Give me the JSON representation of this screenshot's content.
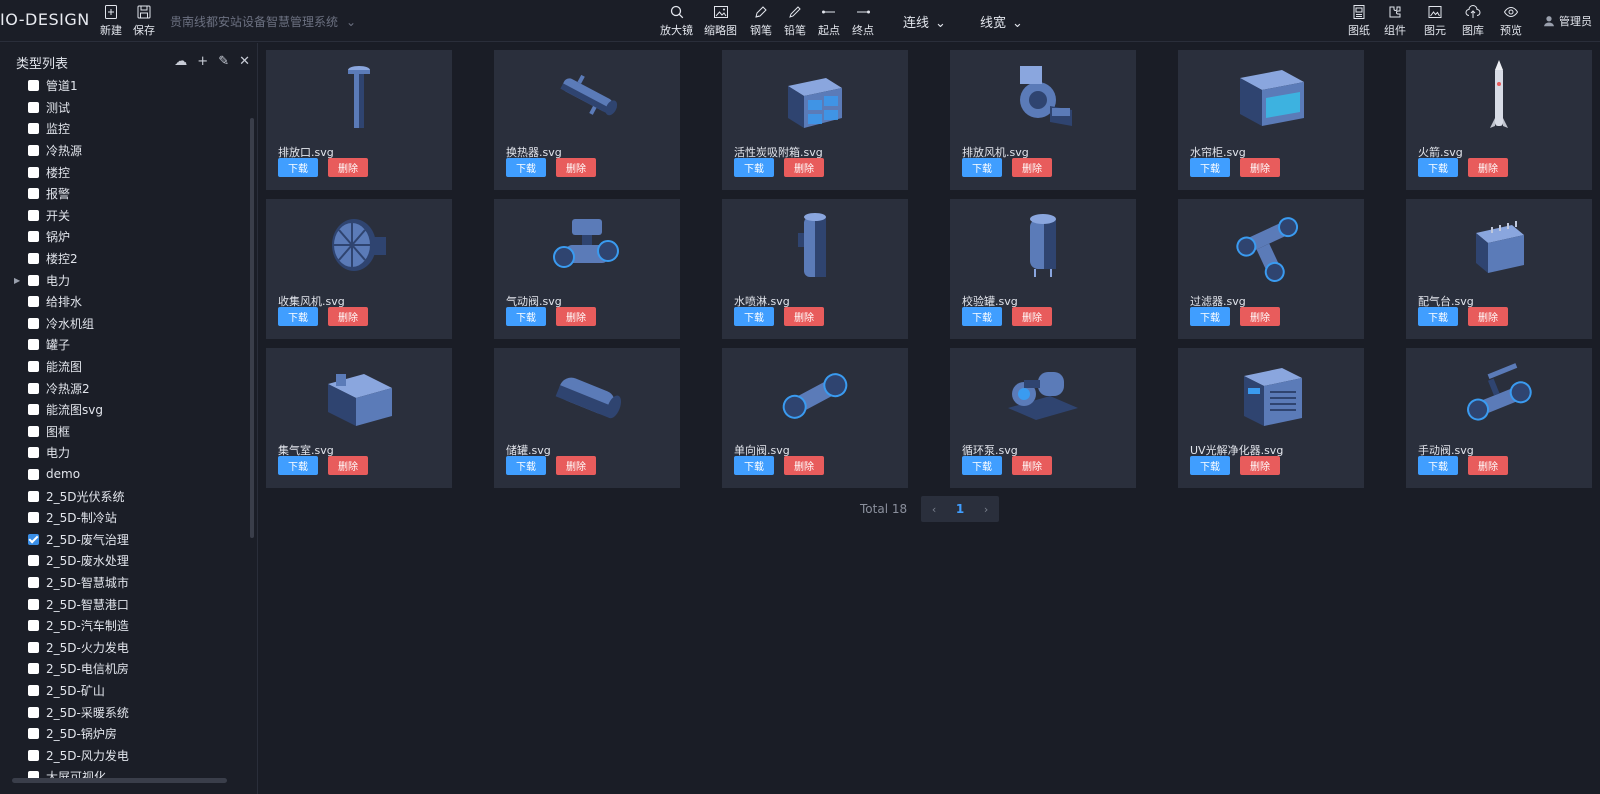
{
  "brand": "IO-DESIGN",
  "toolbar_left": [
    {
      "label": "新建",
      "icon": "new-file-icon"
    },
    {
      "label": "保存",
      "icon": "save-icon"
    }
  ],
  "project_name": "贵南线都安站设备智慧管理系统",
  "toolbar_center": [
    {
      "label": "放大镜",
      "icon": "magnifier-icon"
    },
    {
      "label": "缩略图",
      "icon": "thumbnail-icon"
    },
    {
      "label": "钢笔",
      "icon": "pen-icon"
    },
    {
      "label": "铅笔",
      "icon": "pencil-icon"
    },
    {
      "label": "起点",
      "icon": "start-point-icon"
    },
    {
      "label": "终点",
      "icon": "end-point-icon"
    }
  ],
  "dropdowns": {
    "line": "连线",
    "width": "线宽"
  },
  "toolbar_right": [
    {
      "label": "图纸",
      "icon": "drawing-icon"
    },
    {
      "label": "组件",
      "icon": "component-icon"
    },
    {
      "label": "图元",
      "icon": "image-element-icon"
    },
    {
      "label": "图库",
      "icon": "gallery-upload-icon"
    },
    {
      "label": "预览",
      "icon": "preview-eye-icon"
    }
  ],
  "user": "管理员",
  "sidebar": {
    "title": "类型列表",
    "tools": [
      {
        "icon": "cloud-upload-icon",
        "glyph": "☁"
      },
      {
        "icon": "plus-icon",
        "glyph": "+"
      },
      {
        "icon": "edit-icon",
        "glyph": "✎"
      },
      {
        "icon": "close-icon",
        "glyph": "✕"
      }
    ],
    "items": [
      {
        "label": "管道1",
        "checked": false,
        "expandable": false
      },
      {
        "label": "测试",
        "checked": false,
        "expandable": false
      },
      {
        "label": "监控",
        "checked": false,
        "expandable": false
      },
      {
        "label": "冷热源",
        "checked": false,
        "expandable": false
      },
      {
        "label": "楼控",
        "checked": false,
        "expandable": false
      },
      {
        "label": "报警",
        "checked": false,
        "expandable": false
      },
      {
        "label": "开关",
        "checked": false,
        "expandable": false
      },
      {
        "label": "锅炉",
        "checked": false,
        "expandable": false
      },
      {
        "label": "楼控2",
        "checked": false,
        "expandable": false
      },
      {
        "label": "电力",
        "checked": false,
        "expandable": true
      },
      {
        "label": "给排水",
        "checked": false,
        "expandable": false
      },
      {
        "label": "冷水机组",
        "checked": false,
        "expandable": false
      },
      {
        "label": "罐子",
        "checked": false,
        "expandable": false
      },
      {
        "label": "能流图",
        "checked": false,
        "expandable": false
      },
      {
        "label": "冷热源2",
        "checked": false,
        "expandable": false
      },
      {
        "label": "能流图svg",
        "checked": false,
        "expandable": false
      },
      {
        "label": "图框",
        "checked": false,
        "expandable": false
      },
      {
        "label": "电力",
        "checked": false,
        "expandable": false
      },
      {
        "label": "demo",
        "checked": false,
        "expandable": false
      },
      {
        "label": "2_5D光伏系统",
        "checked": false,
        "expandable": false
      },
      {
        "label": "2_5D-制冷站",
        "checked": false,
        "expandable": false
      },
      {
        "label": "2_5D-废气治理",
        "checked": true,
        "expandable": false
      },
      {
        "label": "2_5D-废水处理",
        "checked": false,
        "expandable": false
      },
      {
        "label": "2_5D-智慧城市",
        "checked": false,
        "expandable": false
      },
      {
        "label": "2_5D-智慧港口",
        "checked": false,
        "expandable": false
      },
      {
        "label": "2_5D-汽车制造",
        "checked": false,
        "expandable": false
      },
      {
        "label": "2_5D-火力发电",
        "checked": false,
        "expandable": false
      },
      {
        "label": "2_5D-电信机房",
        "checked": false,
        "expandable": false
      },
      {
        "label": "2_5D-矿山",
        "checked": false,
        "expandable": false
      },
      {
        "label": "2_5D-采暖系统",
        "checked": false,
        "expandable": false
      },
      {
        "label": "2_5D-锅炉房",
        "checked": false,
        "expandable": false
      },
      {
        "label": "2_5D-风力发电",
        "checked": false,
        "expandable": false
      },
      {
        "label": "大屏可视化",
        "checked": false,
        "expandable": false
      }
    ]
  },
  "buttons": {
    "download": "下载",
    "delete": "删除"
  },
  "items": [
    {
      "name": "排放口.svg",
      "icon": "exhaust-stack-icon"
    },
    {
      "name": "换热器.svg",
      "icon": "heat-exchanger-icon"
    },
    {
      "name": "活性炭吸附箱.svg",
      "icon": "carbon-adsorption-box-icon"
    },
    {
      "name": "排放风机.svg",
      "icon": "exhaust-fan-icon"
    },
    {
      "name": "水帘柜.svg",
      "icon": "water-curtain-cabinet-icon"
    },
    {
      "name": "火箭.svg",
      "icon": "rocket-icon"
    },
    {
      "name": "收集风机.svg",
      "icon": "collection-fan-icon"
    },
    {
      "name": "气动阀.svg",
      "icon": "pneumatic-valve-icon"
    },
    {
      "name": "水喷淋.svg",
      "icon": "water-spray-tower-icon"
    },
    {
      "name": "校验罐.svg",
      "icon": "check-tank-icon"
    },
    {
      "name": "过滤器.svg",
      "icon": "filter-icon"
    },
    {
      "name": "配气台.svg",
      "icon": "gas-distribution-panel-icon"
    },
    {
      "name": "集气室.svg",
      "icon": "gas-chamber-icon"
    },
    {
      "name": "储罐.svg",
      "icon": "storage-tank-icon"
    },
    {
      "name": "单向阀.svg",
      "icon": "check-valve-icon"
    },
    {
      "name": "循环泵.svg",
      "icon": "circulation-pump-icon"
    },
    {
      "name": "UV光解净化器.svg",
      "icon": "uv-purifier-icon"
    },
    {
      "name": "手动阀.svg",
      "icon": "manual-valve-icon"
    }
  ],
  "pagination": {
    "total": "Total 18",
    "prev": "‹",
    "current": "1",
    "next": "›"
  },
  "colors": {
    "accent": "#409eff",
    "danger": "#e85c5c",
    "card": "#2a2f3c",
    "bg": "#1a1d26"
  }
}
